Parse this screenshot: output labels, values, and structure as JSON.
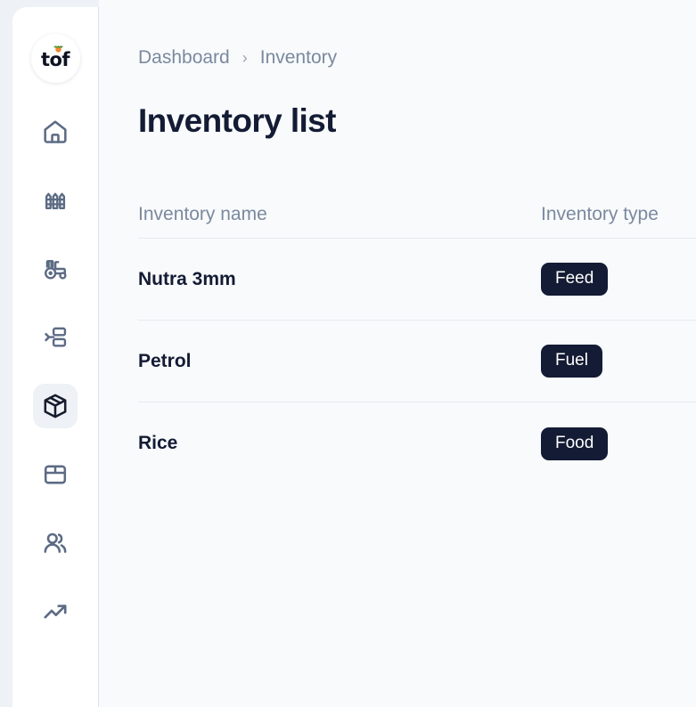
{
  "sidebar": {
    "logo": {
      "text": "tof",
      "icon": "tomato-logo-icon"
    },
    "items": [
      {
        "id": "home",
        "icon": "home-icon",
        "active": false
      },
      {
        "id": "fields",
        "icon": "fence-icon",
        "active": false
      },
      {
        "id": "machinery",
        "icon": "tractor-icon",
        "active": false
      },
      {
        "id": "tasks",
        "icon": "workflow-icon",
        "active": false
      },
      {
        "id": "inventory",
        "icon": "box-3d-icon",
        "active": true
      },
      {
        "id": "storage",
        "icon": "package-icon",
        "active": false
      },
      {
        "id": "team",
        "icon": "users-icon",
        "active": false
      },
      {
        "id": "reports",
        "icon": "trending-up-icon",
        "active": false
      }
    ]
  },
  "breadcrumb": {
    "items": [
      "Dashboard",
      "Inventory"
    ],
    "separator": "›"
  },
  "page": {
    "title": "Inventory list"
  },
  "table": {
    "columns": [
      "Inventory name",
      "Inventory type"
    ],
    "rows": [
      {
        "name": "Nutra 3mm",
        "type": "Feed"
      },
      {
        "name": "Petrol",
        "type": "Fuel"
      },
      {
        "name": "Rice",
        "type": "Food"
      }
    ]
  },
  "colors": {
    "page_background": "#eef1f6",
    "content_background": "#f8fafc",
    "sidebar_background": "#ffffff",
    "text_primary": "#141b34",
    "text_muted": "#7b899e",
    "icon_inactive": "#5c6b84",
    "badge_background": "#141b34",
    "badge_text": "#ffffff",
    "divider": "#e6eaf0"
  }
}
